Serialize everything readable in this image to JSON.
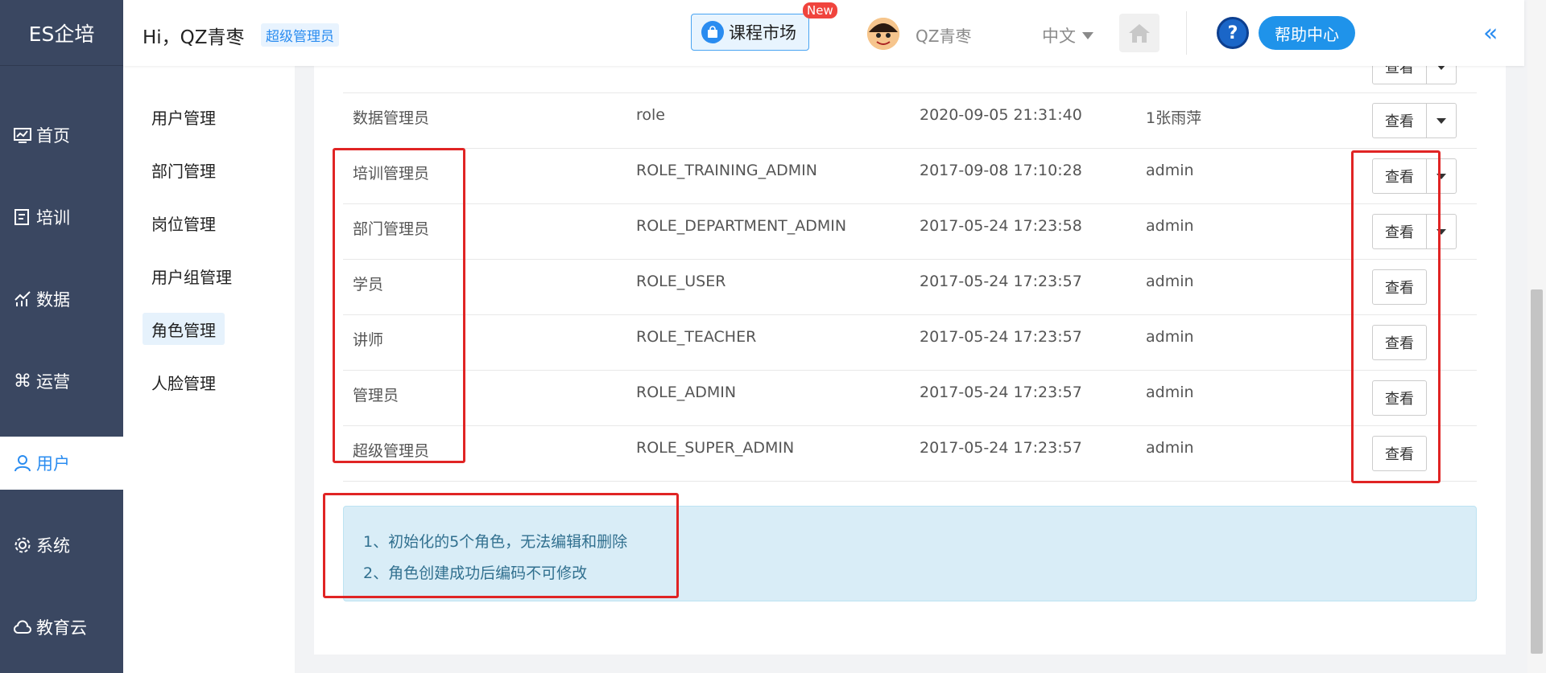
{
  "sidebar": {
    "brand": "ES企培",
    "items": [
      {
        "label": "首页",
        "icon": "chart-icon"
      },
      {
        "label": "培训",
        "icon": "book-icon"
      },
      {
        "label": "数据",
        "icon": "bar-chart-icon"
      },
      {
        "label": "运营",
        "icon": "command-icon"
      },
      {
        "label": "用户",
        "icon": "user-icon",
        "active": true
      },
      {
        "label": "系统",
        "icon": "gear-icon"
      },
      {
        "label": "教育云",
        "icon": "cloud-icon"
      }
    ]
  },
  "header": {
    "greeting": "Hi，QZ青枣",
    "role_badge": "超级管理员",
    "market_label": "课程市场",
    "new_badge": "New",
    "username": "QZ青枣",
    "language": "中文",
    "help_label": "帮助中心",
    "help_icon_text": "?",
    "collapse_icon": "«"
  },
  "submenu": {
    "items": [
      "用户管理",
      "部门管理",
      "岗位管理",
      "用户组管理",
      "角色管理",
      "人脸管理"
    ],
    "active": "角色管理"
  },
  "table": {
    "view_label": "查看",
    "rows": [
      {
        "name": "数据管理员",
        "code": "role",
        "created": "2020-09-05 21:31:40",
        "creator": "1张雨萍",
        "dropdown": true
      },
      {
        "name": "培训管理员",
        "code": "ROLE_TRAINING_ADMIN",
        "created": "2017-09-08 17:10:28",
        "creator": "admin",
        "dropdown": true
      },
      {
        "name": "部门管理员",
        "code": "ROLE_DEPARTMENT_ADMIN",
        "created": "2017-05-24 17:23:58",
        "creator": "admin",
        "dropdown": true
      },
      {
        "name": "学员",
        "code": "ROLE_USER",
        "created": "2017-05-24 17:23:57",
        "creator": "admin",
        "dropdown": false
      },
      {
        "name": "讲师",
        "code": "ROLE_TEACHER",
        "created": "2017-05-24 17:23:57",
        "creator": "admin",
        "dropdown": false
      },
      {
        "name": "管理员",
        "code": "ROLE_ADMIN",
        "created": "2017-05-24 17:23:57",
        "creator": "admin",
        "dropdown": false
      },
      {
        "name": "超级管理员",
        "code": "ROLE_SUPER_ADMIN",
        "created": "2017-05-24 17:23:57",
        "creator": "admin",
        "dropdown": false
      }
    ]
  },
  "note": {
    "line1": "1、初始化的5个角色，无法编辑和删除",
    "line2": "2、角色创建成功后编码不可修改"
  },
  "colors": {
    "sidebar_bg": "#3a4761",
    "accent": "#2a8cf0",
    "highlight": "#e02424",
    "note_bg": "#d9edf7"
  }
}
